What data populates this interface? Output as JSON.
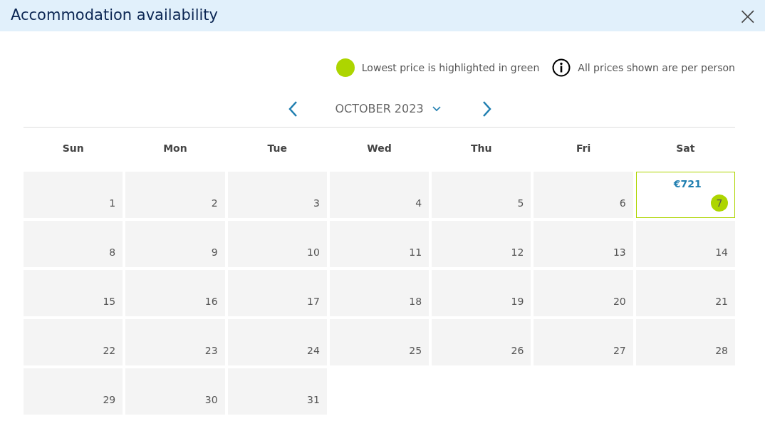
{
  "window": {
    "title": "Accommodation availability",
    "close": "×"
  },
  "legend": {
    "lowest": "Lowest price is highlighted in green",
    "info": "All prices shown are per person"
  },
  "month": {
    "label": "OCTOBER 2023"
  },
  "weekdays": [
    "Sun",
    "Mon",
    "Tue",
    "Wed",
    "Thu",
    "Fri",
    "Sat"
  ],
  "days": [
    {
      "day": "1",
      "lowest": false
    },
    {
      "day": "2",
      "lowest": false
    },
    {
      "day": "3",
      "lowest": false
    },
    {
      "day": "4",
      "lowest": false
    },
    {
      "day": "5",
      "lowest": false
    },
    {
      "day": "6",
      "lowest": false
    },
    {
      "day": "7",
      "price": "€721",
      "lowest": true
    },
    {
      "day": "8",
      "lowest": false
    },
    {
      "day": "9",
      "lowest": false
    },
    {
      "day": "10",
      "lowest": false
    },
    {
      "day": "11",
      "lowest": false
    },
    {
      "day": "12",
      "lowest": false
    },
    {
      "day": "13",
      "lowest": false
    },
    {
      "day": "14",
      "lowest": false
    },
    {
      "day": "15",
      "lowest": false
    },
    {
      "day": "16",
      "lowest": false
    },
    {
      "day": "17",
      "lowest": false
    },
    {
      "day": "18",
      "lowest": false
    },
    {
      "day": "19",
      "lowest": false
    },
    {
      "day": "20",
      "lowest": false
    },
    {
      "day": "21",
      "lowest": false
    },
    {
      "day": "22",
      "lowest": false
    },
    {
      "day": "23",
      "lowest": false
    },
    {
      "day": "24",
      "lowest": false
    },
    {
      "day": "25",
      "lowest": false
    },
    {
      "day": "26",
      "lowest": false
    },
    {
      "day": "27",
      "lowest": false
    },
    {
      "day": "28",
      "lowest": false
    },
    {
      "day": "29",
      "lowest": false
    },
    {
      "day": "30",
      "lowest": false
    },
    {
      "day": "31",
      "lowest": false
    }
  ]
}
